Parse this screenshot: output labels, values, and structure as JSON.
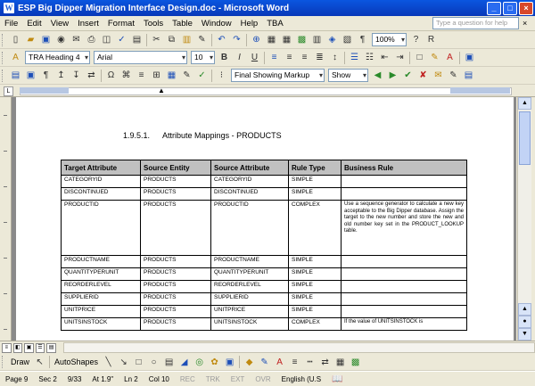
{
  "window": {
    "title": "ESP Big Dipper Migration Interface Design.doc - Microsoft Word",
    "app_icon": "W",
    "minimize": "_",
    "maximize": "□",
    "close": "×"
  },
  "menu": {
    "items": [
      "File",
      "Edit",
      "View",
      "Insert",
      "Format",
      "Tools",
      "Table",
      "Window",
      "Help",
      "TBA"
    ],
    "help_placeholder": "Type a question for help",
    "close_doc": "×"
  },
  "toolbar_standard": {
    "icons": [
      "new-icon",
      "open-icon",
      "save-icon",
      "permission-icon",
      "email-icon",
      "print-icon",
      "print-preview-icon",
      "spelling-icon",
      "research-icon",
      "cut-icon",
      "copy-icon",
      "paste-icon",
      "format-painter-icon",
      "undo-icon",
      "redo-icon",
      "hyperlink-icon",
      "tables-borders-icon",
      "insert-table-icon",
      "insert-excel-icon",
      "columns-icon",
      "drawing-icon",
      "document-map-icon",
      "show-hide-icon"
    ],
    "zoom": "100%",
    "read": "R"
  },
  "toolbar_formatting": {
    "style": "TRA Heading 4",
    "font": "Arial",
    "size": "10",
    "bold": "B",
    "italic": "I",
    "underline": "U"
  },
  "toolbar_reviewing": {
    "display_for_review": "Final Showing Markup",
    "show": "Show"
  },
  "ruler": {
    "tab_selector": "L",
    "indent_marker": "▲"
  },
  "document": {
    "heading_number": "1.9.5.1.",
    "heading_text": "Attribute Mappings - PRODUCTS",
    "table": {
      "headers": [
        "Target Attribute",
        "Source Entity",
        "Source Attribute",
        "Rule Type",
        "Business Rule"
      ],
      "rows": [
        [
          "CATEGORYID",
          "PRODUCTS",
          "CATEGORYID",
          "SIMPLE",
          ""
        ],
        [
          "DISCONTINUED",
          "PRODUCTS",
          "DISCONTINUED",
          "SIMPLE",
          ""
        ],
        [
          "PRODUCTID",
          "PRODUCTS",
          "PRODUCTID",
          "COMPLEX",
          "Use a sequence generator to calculate a new key acceptable to the Big Dipper database. Assign the target to the new number and store the new and old number key set in the PRODUCT_LOOKUP table."
        ],
        [
          "PRODUCTNAME",
          "PRODUCTS",
          "PRODUCTNAME",
          "SIMPLE",
          ""
        ],
        [
          "QUANTITYPERUNIT",
          "PRODUCTS",
          "QUANTITYPERUNIT",
          "SIMPLE",
          ""
        ],
        [
          "REORDERLEVEL",
          "PRODUCTS",
          "REORDERLEVEL",
          "SIMPLE",
          ""
        ],
        [
          "SUPPLIERID",
          "PRODUCTS",
          "SUPPLIERID",
          "SIMPLE",
          ""
        ],
        [
          "UNITPRICE",
          "PRODUCTS",
          "UNITPRICE",
          "SIMPLE",
          ""
        ],
        [
          "UNITSINSTOCK",
          "PRODUCTS",
          "UNITSINSTOCK",
          "COMPLEX",
          "If the value of UNITSINSTOCK is"
        ]
      ]
    }
  },
  "drawing_toolbar": {
    "draw": "Draw",
    "autoshapes": "AutoShapes"
  },
  "status": {
    "page": "Page 9",
    "section": "Sec 2",
    "page_of": "9/33",
    "at": "At 1.9\"",
    "line": "Ln 2",
    "col": "Col 10",
    "rec": "REC",
    "trk": "TRK",
    "ext": "EXT",
    "ovr": "OVR",
    "language": "English (U.S"
  }
}
